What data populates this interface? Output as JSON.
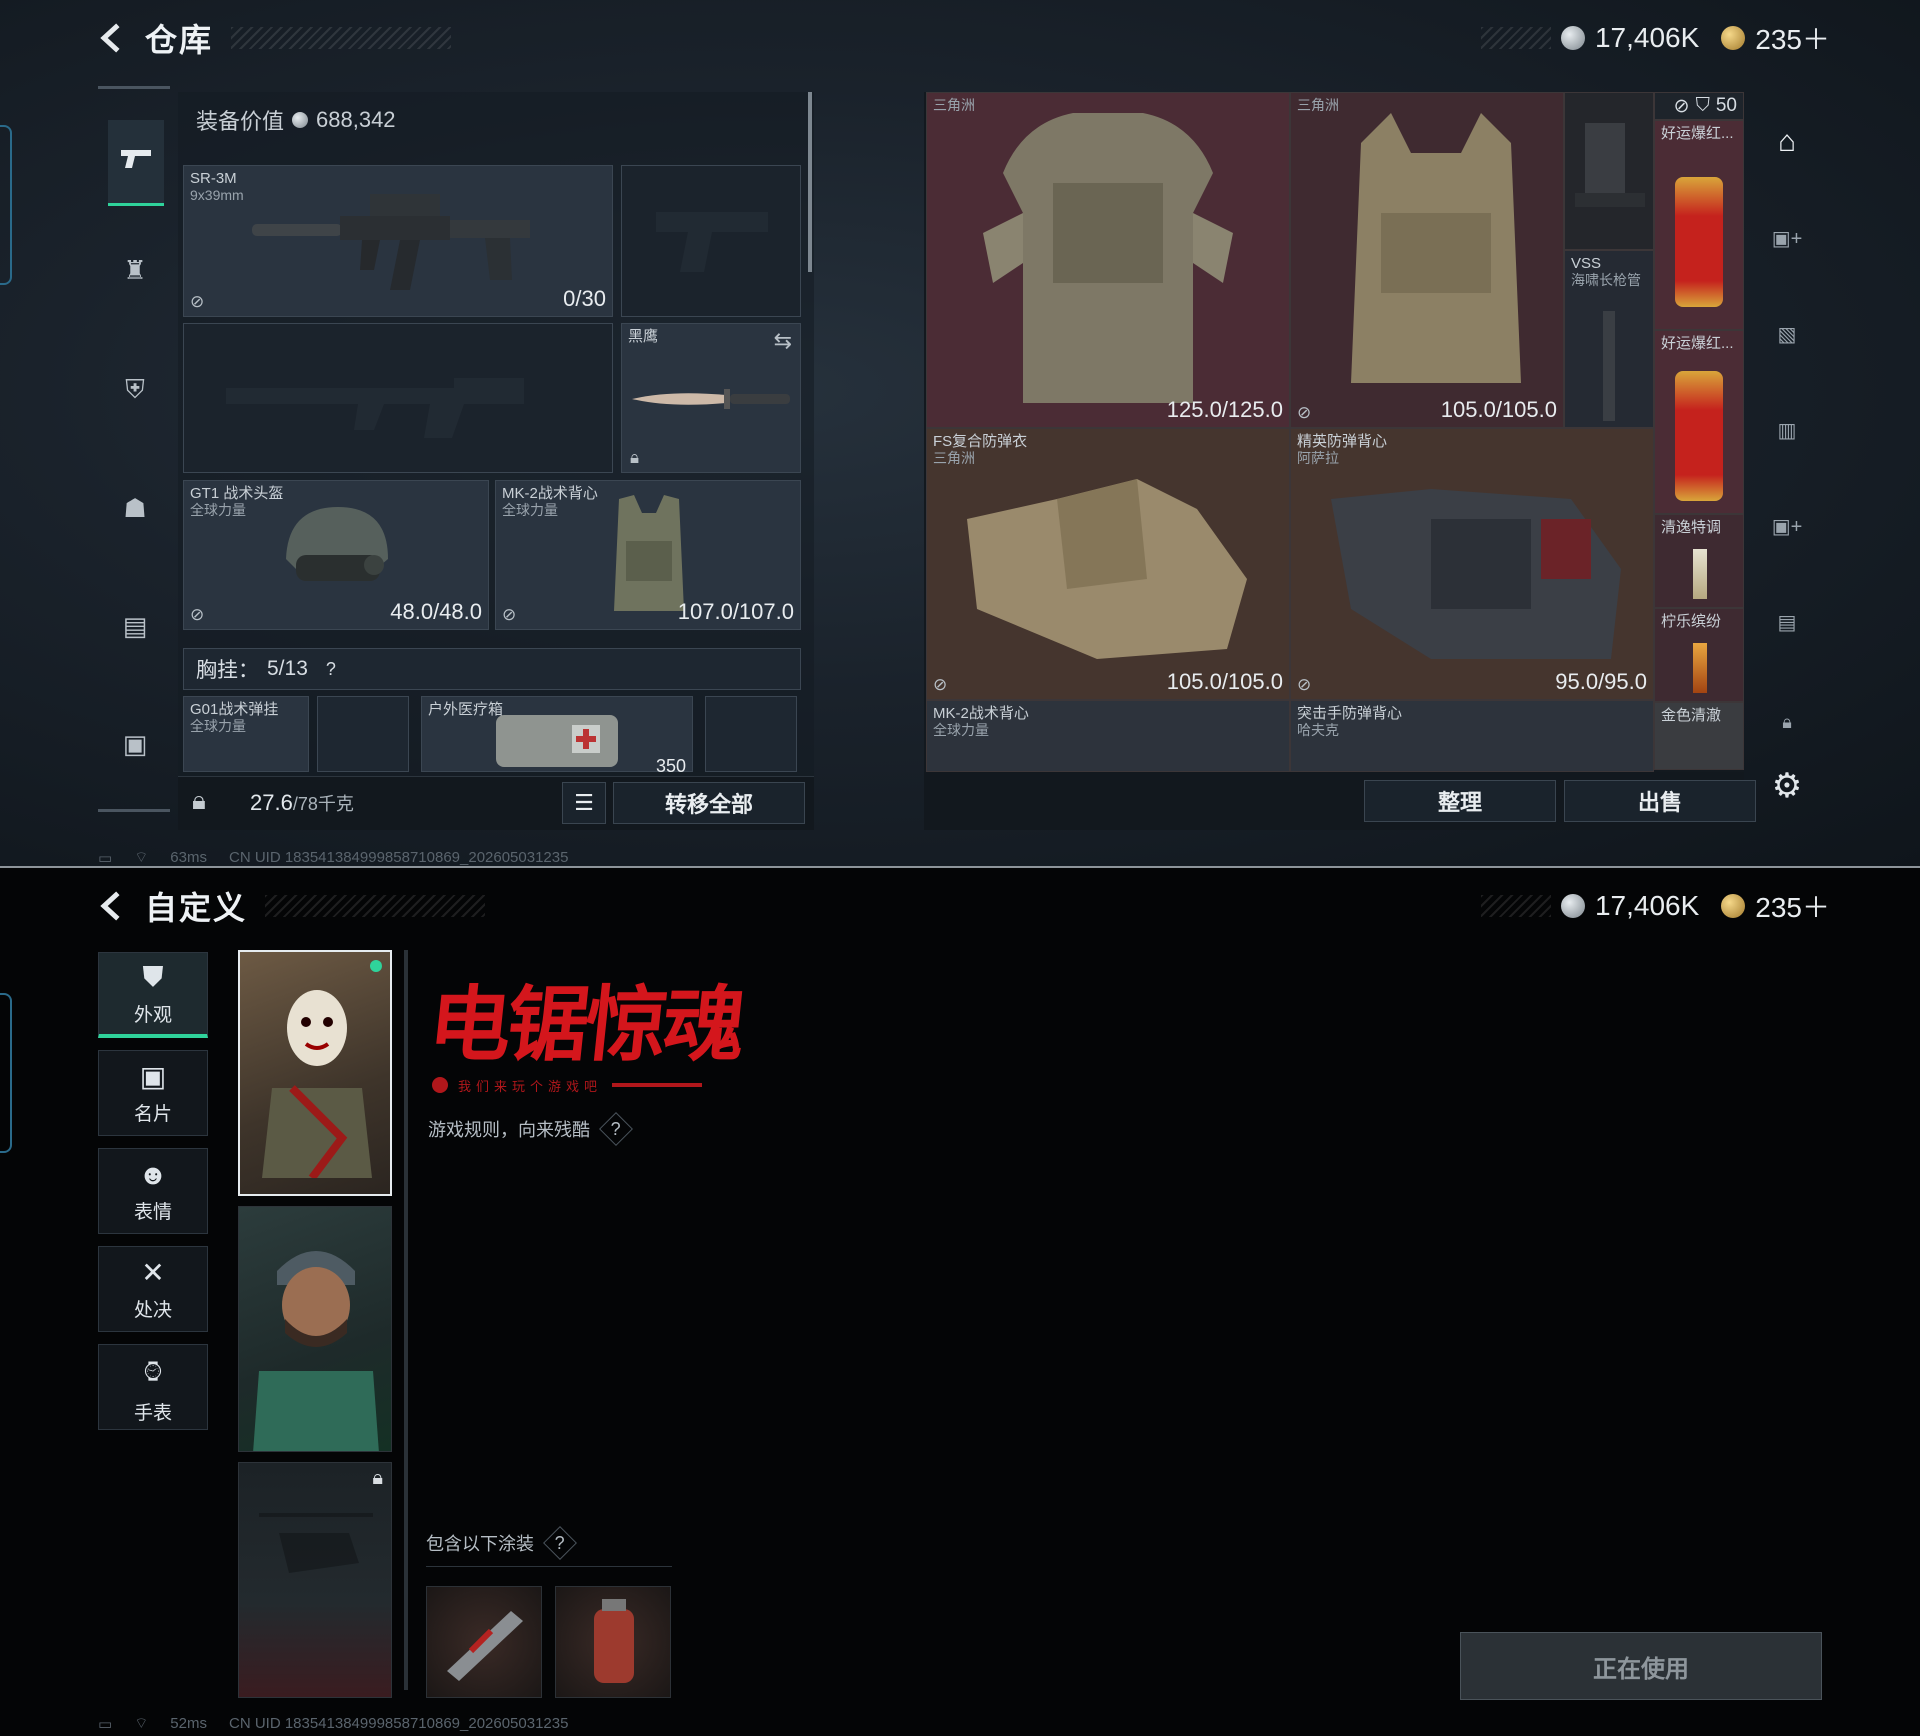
{
  "warehouse": {
    "title": "仓库",
    "currency1": "17,406K",
    "currency2": "235＋",
    "equip_value_label": "装备价值",
    "equip_value": "688,342",
    "primary": {
      "name": "SR-3M",
      "caliber": "9x39mm",
      "ammo": "0/30"
    },
    "melee": {
      "name": "黑鹰"
    },
    "helmet": {
      "name": "GT1 战术头盔",
      "brand": "全球力量",
      "durability": "48.0/48.0"
    },
    "armor": {
      "name": "MK-2战术背心",
      "brand": "全球力量",
      "durability": "107.0/107.0"
    },
    "chest_rig_label": "胸挂：",
    "chest_rig_capacity": "5/13",
    "chest_rig_help": "?",
    "chest_items": [
      {
        "name": "G01战术弹挂",
        "brand": "全球力量"
      },
      {
        "name": "户外医疗箱",
        "count": "350"
      }
    ],
    "weight": "27.6",
    "weight_max": "/78千克",
    "transfer_all": "转移全部",
    "stash": [
      {
        "name": "",
        "brand": "三角洲",
        "durability": "125.0/125.0"
      },
      {
        "name": "",
        "brand": "三角洲",
        "durability": "105.0/105.0"
      },
      {
        "name": "FS复合防弹衣",
        "brand": "三角洲",
        "durability": "105.0/105.0"
      },
      {
        "name": "精英防弹背心",
        "brand": "阿萨拉",
        "durability": "95.0/95.0"
      },
      {
        "name": "MK-2战术背心",
        "brand": "全球力量"
      },
      {
        "name": "突击手防弹背心",
        "brand": "哈夫克"
      }
    ],
    "vss": {
      "name": "VSS",
      "desc": "海啸长枪管"
    },
    "small_items": [
      {
        "name": "好运爆红..."
      },
      {
        "name": "好运爆红..."
      },
      {
        "name": "清逸特调"
      },
      {
        "name": "柠乐缤纷"
      },
      {
        "name": "金色清澈"
      }
    ],
    "stack_count": "50",
    "sort_btn": "整理",
    "sell_btn": "出售",
    "status_ping": "63ms",
    "status_uid": "CN UID 1835413849998587108​69_202605031235"
  },
  "customize": {
    "title": "自定义",
    "currency1": "17,406K",
    "currency2": "235＋",
    "tabs": [
      {
        "label": "外观",
        "icon": "jacket-icon"
      },
      {
        "label": "名片",
        "icon": "card-icon"
      },
      {
        "label": "表情",
        "icon": "smile-icon"
      },
      {
        "label": "处决",
        "icon": "crossed-blades-icon"
      },
      {
        "label": "手表",
        "icon": "watch-icon"
      }
    ],
    "logo_title": "电锯惊魂",
    "logo_tagline": "我们来玩个游戏吧",
    "skin_desc": "游戏规则，向来残酷",
    "skin_help": "?",
    "includes_label": "包含以下涂装",
    "includes_help": "?",
    "in_use_btn": "正在使用",
    "status_ping": "52ms",
    "status_uid": "CN UID 1835413849998587108​69_202605031235"
  },
  "colors": {
    "accent_green": "#2fd39b",
    "logo_red": "#d4161c"
  }
}
